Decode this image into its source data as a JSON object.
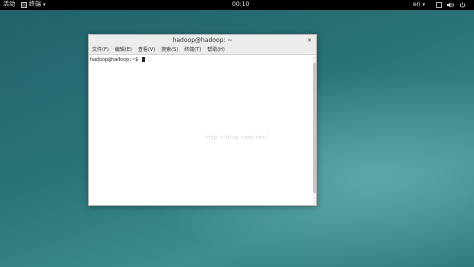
{
  "topbar": {
    "activities": "活动",
    "app_name": "终端",
    "clock": "00:10",
    "lang": "en"
  },
  "window": {
    "title": "hadoop@hadoop: ~",
    "close": "×"
  },
  "menu": [
    "文件(F)",
    "编辑(E)",
    "查看(V)",
    "搜索(S)",
    "终端(T)",
    "帮助(H)"
  ],
  "terminal": {
    "prompt": "hadoop@hadoop:~$ ",
    "watermark": "http://blog.csdn.net/"
  },
  "icons": {
    "app": "terminal-icon",
    "system": [
      "accessibility-icon",
      "volume-icon",
      "power-icon"
    ]
  }
}
